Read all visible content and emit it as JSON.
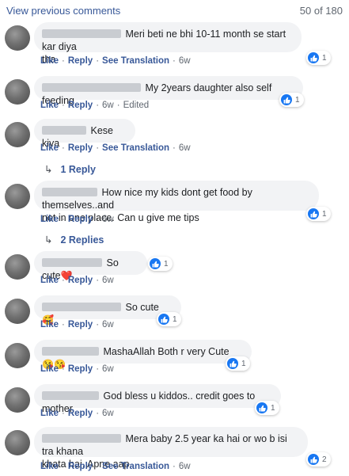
{
  "header": {
    "view_previous": "View previous comments",
    "count": "50 of 180"
  },
  "like_label": "Like",
  "reply_label": "Reply",
  "see_translation_label": "See Translation",
  "edited_label": "Edited",
  "icons": {
    "like_reaction": "thumbs-up-icon",
    "reply_arrow": "reply-arrow-icon"
  },
  "colors": {
    "link": "#385898",
    "like_blue": "#1877f2",
    "bubble_bg": "#f2f3f5"
  },
  "comments": [
    {
      "text": "Meri beti ne bhi 10-11 month se start kar diya",
      "text2": "tha",
      "reactions": "1",
      "time": "6w",
      "has_translation": true
    },
    {
      "text": "My 2years daughter also self feeding",
      "reactions": "1",
      "time": "6w",
      "edited": true
    },
    {
      "text": "Kese kiya",
      "time": "6w",
      "has_translation": true,
      "replies": "1 Reply"
    },
    {
      "text": "How nice my kids dont get food by themselves..and",
      "text2": "not in one place. Can u give me tips",
      "reactions": "1",
      "time": "6w",
      "replies": "2 Replies"
    },
    {
      "text": "So cute",
      "emoji": "❤️",
      "reactions": "1",
      "time": "6w"
    },
    {
      "text": "So cute",
      "emoji": "🥰",
      "reactions": "1",
      "time": "6w"
    },
    {
      "text": "MashaAllah Both r very Cute",
      "emoji": "😘😘",
      "reactions": "1",
      "time": "6w"
    },
    {
      "text": "God bless u kiddos.. credit goes to mother",
      "reactions": "1",
      "time": "6w"
    },
    {
      "text": "Mera baby 2.5 year ka hai or wo b isi tra khana",
      "text2": "khata hai. Apne aap",
      "reactions": "2",
      "time": "6w",
      "has_translation": true
    }
  ]
}
